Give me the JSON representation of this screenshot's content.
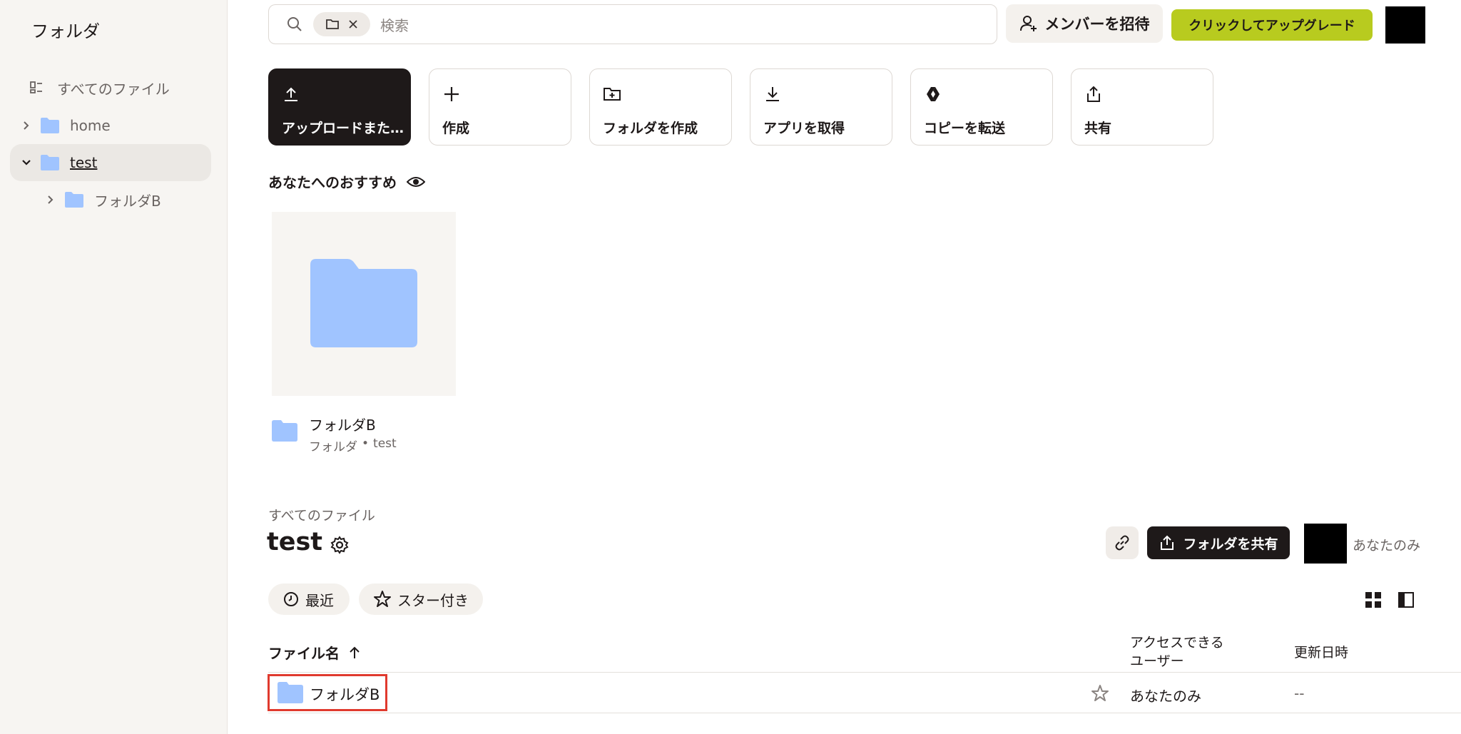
{
  "sidebar": {
    "title": "フォルダ",
    "all_files": "すべてのファイル",
    "items": [
      {
        "label": "home"
      },
      {
        "label": "test"
      },
      {
        "label": "フォルダB"
      }
    ]
  },
  "topbar": {
    "search_placeholder": "検索",
    "invite_label": "メンバーを招待",
    "upgrade_label": "クリックしてアップグレード"
  },
  "actions": [
    {
      "label": "アップロードまた…",
      "icon": "upload-icon"
    },
    {
      "label": "作成",
      "icon": "plus-icon"
    },
    {
      "label": "フォルダを作成",
      "icon": "folder-plus-icon"
    },
    {
      "label": "アプリを取得",
      "icon": "download-icon"
    },
    {
      "label": "コピーを転送",
      "icon": "transfer-icon"
    },
    {
      "label": "共有",
      "icon": "share-icon"
    }
  ],
  "suggestions": {
    "title": "あなたへのおすすめ",
    "items": [
      {
        "name": "フォルダB",
        "type": "フォルダ",
        "location": "test"
      }
    ]
  },
  "folder": {
    "breadcrumb": "すべてのファイル",
    "title": "test",
    "share_label": "フォルダを共有",
    "access_label": "あなたのみ"
  },
  "filters": {
    "recent": "最近",
    "starred": "スター付き"
  },
  "table": {
    "col_name": "ファイル名",
    "col_access_1": "アクセスできる",
    "col_access_2": "ユーザー",
    "col_modified": "更新日時",
    "rows": [
      {
        "name": "フォルダB",
        "access": "あなたのみ",
        "modified": "--"
      }
    ]
  },
  "colors": {
    "accent_upgrade": "#b8cb1f",
    "folder_blue": "#a0c4ff",
    "dark": "#1e1919",
    "selection_highlight": "#e03a2e"
  }
}
